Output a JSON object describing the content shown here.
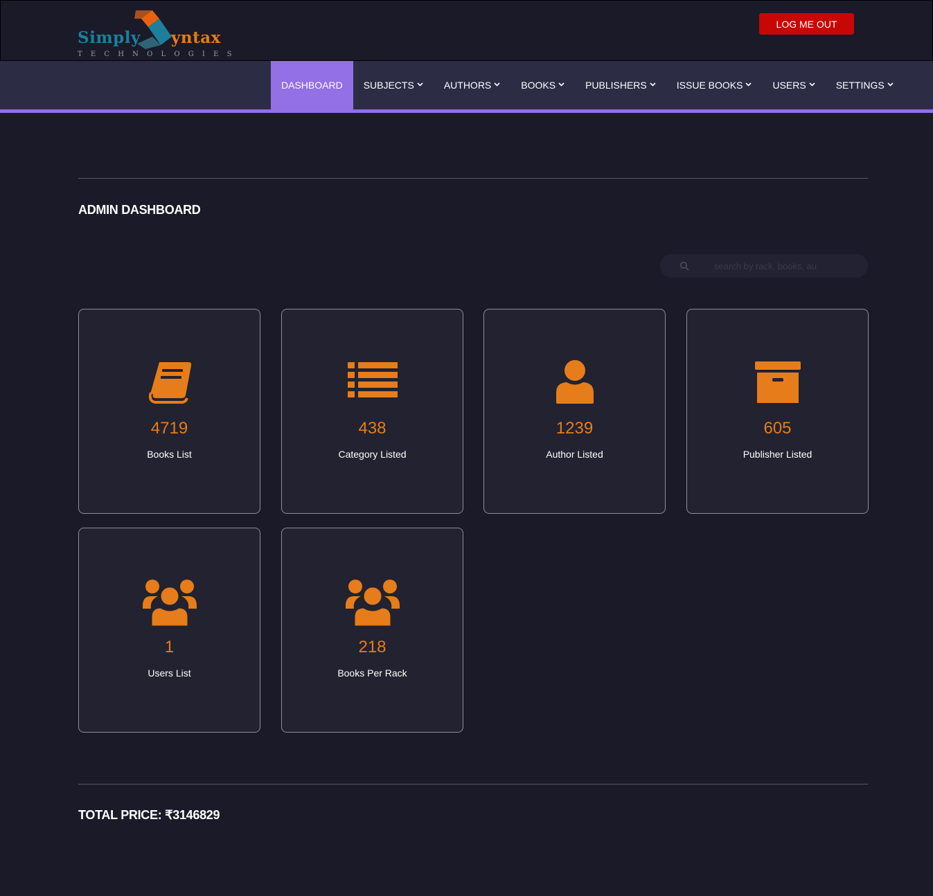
{
  "brand": {
    "word1": "Simply",
    "word2": "yntax",
    "tagline": "TECHNOLOGIES",
    "primary_color": "#1d7f9b",
    "accent_color": "#e57d14"
  },
  "header": {
    "logout_label": "LOG ME OUT",
    "logout_color": "#c90606"
  },
  "nav": {
    "accent_color": "#9370e5",
    "items": [
      {
        "label": "DASHBOARD",
        "active": true
      },
      {
        "label": "SUBJECTS",
        "dropdown": true
      },
      {
        "label": "AUTHORS",
        "dropdown": true
      },
      {
        "label": "BOOKS",
        "dropdown": true
      },
      {
        "label": "PUBLISHERS",
        "dropdown": true
      },
      {
        "label": "ISSUE BOOKS",
        "dropdown": true
      },
      {
        "label": "USERS",
        "dropdown": true
      },
      {
        "label": "SETTINGS",
        "dropdown": true
      }
    ]
  },
  "main": {
    "title": "ADMIN DASHBOARD",
    "search": {
      "placeholder": "search by rack, books, au",
      "value": ""
    },
    "cards": [
      {
        "value": "4719",
        "label": "Books List",
        "icon": "book-icon"
      },
      {
        "value": "438",
        "label": "Category Listed",
        "icon": "list-icon"
      },
      {
        "value": "1239",
        "label": "Author Listed",
        "icon": "user-icon"
      },
      {
        "value": "605",
        "label": "Publisher Listed",
        "icon": "archive-icon"
      },
      {
        "value": "1",
        "label": "Users List",
        "icon": "users-icon"
      },
      {
        "value": "218",
        "label": "Books Per Rack",
        "icon": "users-icon"
      }
    ],
    "card_accent_color": "#e67d1a",
    "total_price": "TOTAL PRICE: ₹3146829"
  }
}
